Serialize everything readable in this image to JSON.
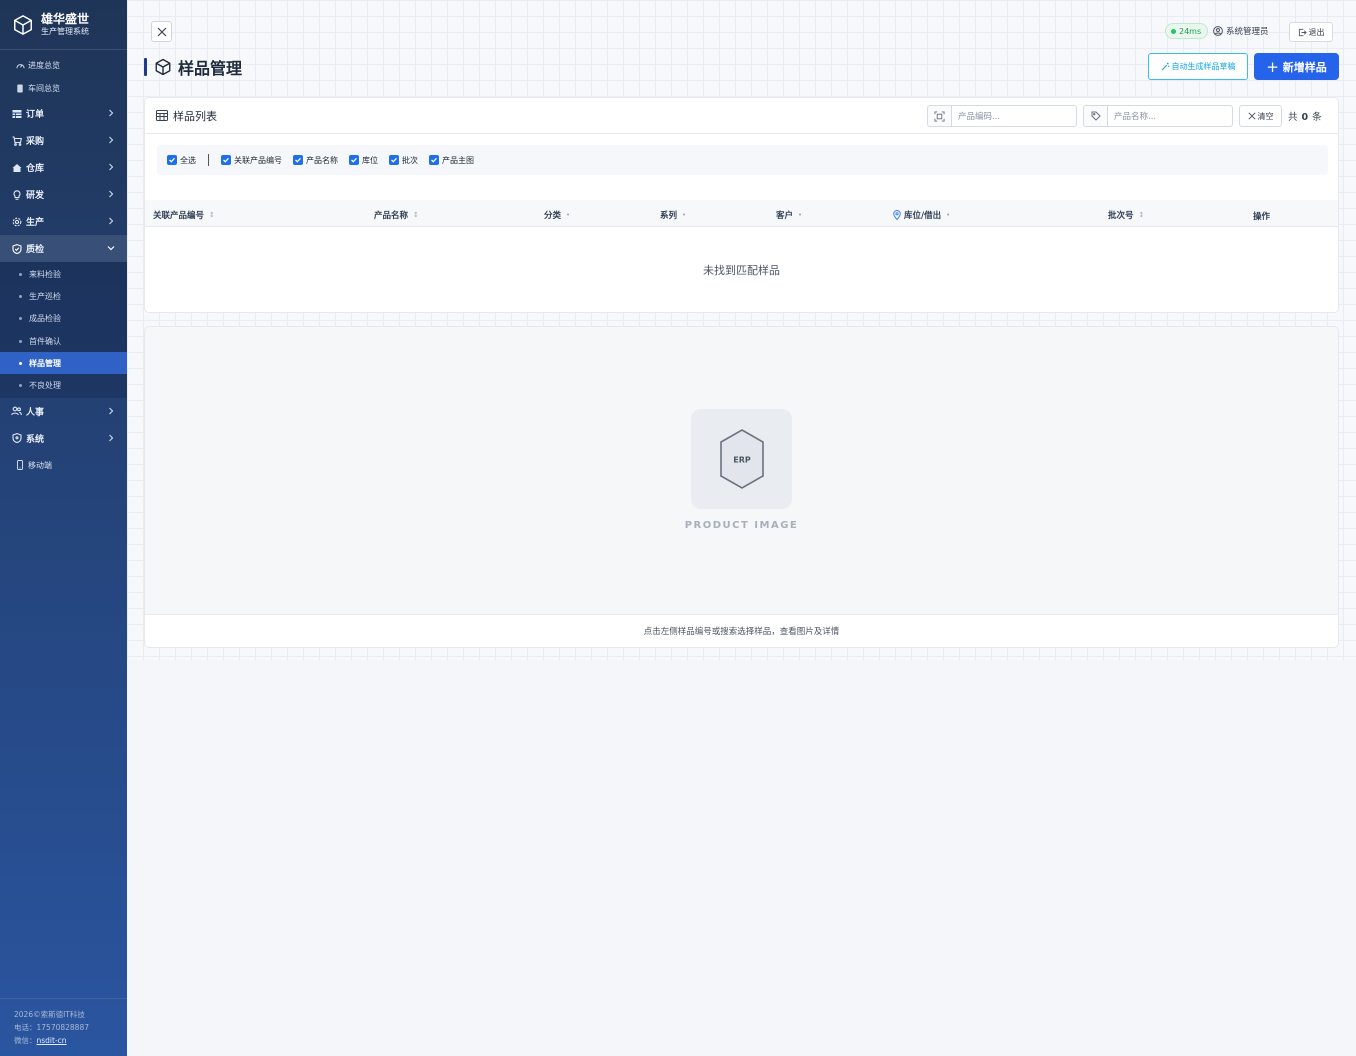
{
  "brand": {
    "title": "雄华盛世",
    "subtitle": "生产管理系统"
  },
  "nav": {
    "top_links": [
      {
        "label": "进度总览",
        "icon": "gauge-icon"
      },
      {
        "label": "车间总览",
        "icon": "document-icon"
      }
    ],
    "groups": [
      {
        "label": "订单",
        "icon": "table-icon"
      },
      {
        "label": "采购",
        "icon": "cart-icon"
      },
      {
        "label": "仓库",
        "icon": "home-icon"
      },
      {
        "label": "研发",
        "icon": "bulb-icon"
      },
      {
        "label": "生产",
        "icon": "gear-icon"
      },
      {
        "label": "质检",
        "icon": "shield-check-icon",
        "expanded": true
      },
      {
        "label": "人事",
        "icon": "users-icon"
      },
      {
        "label": "系统",
        "icon": "shield-icon"
      },
      {
        "label": "移动端",
        "icon": "mobile-icon"
      }
    ],
    "quality_items": [
      "来料检验",
      "生产巡检",
      "成品检验",
      "首件确认",
      "样品管理",
      "不良处理"
    ],
    "active_item": "样品管理"
  },
  "footer": {
    "copyright": "2026©索斯德IT科技",
    "phone": "电话：17570828887",
    "wechat_label": "微信：",
    "wechat_id": "nsdit-cn"
  },
  "topbar": {
    "latency": "24ms",
    "user": "系统管理员",
    "logout": "退出"
  },
  "page": {
    "title": "样品管理",
    "auto_btn": "自动生成样品草稿",
    "new_btn": "新增样品"
  },
  "list": {
    "title": "样品列表",
    "code_placeholder": "产品编码...",
    "name_placeholder": "产品名称...",
    "clear": "清空",
    "count_prefix": "共",
    "count": "0",
    "count_suffix": "条",
    "filters": [
      "全选",
      "关联产品编号",
      "产品名称",
      "库位",
      "批次",
      "产品主图"
    ],
    "columns": [
      "关联产品编号",
      "产品名称",
      "分类",
      "系列",
      "客户",
      "库位/借出",
      "批次号",
      "操作"
    ],
    "empty": "未找到匹配样品"
  },
  "preview": {
    "placeholder_text": "ERP",
    "placeholder_label": "PRODUCT IMAGE",
    "hint": "点击左侧样品编号或搜索选择样品，查看图片及详情"
  },
  "colors": {
    "primary": "#2563eb",
    "sidebar_top": "#1f3557",
    "sidebar_bottom": "#2a55a0",
    "active": "#2f62c4",
    "success": "#22c55e"
  }
}
